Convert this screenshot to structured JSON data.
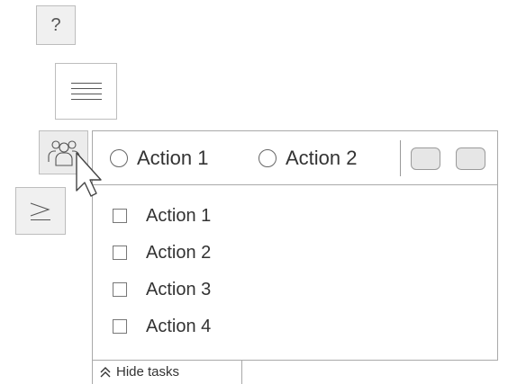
{
  "side_buttons": {
    "help": {
      "glyph": "?",
      "icon": "question-icon"
    },
    "menu": {
      "icon": "hamburger-menu-icon"
    },
    "people": {
      "icon": "people-group-icon"
    },
    "terminal": {
      "icon": "terminal-prompt-icon"
    }
  },
  "panel": {
    "radios": [
      {
        "label": "Action 1"
      },
      {
        "label": "Action 2"
      }
    ],
    "tasks": [
      {
        "label": "Action 1"
      },
      {
        "label": "Action 2"
      },
      {
        "label": "Action 3"
      },
      {
        "label": "Action 4"
      }
    ],
    "footer": {
      "label": "Hide tasks",
      "icon": "double-chevron-up-icon"
    }
  },
  "colors": {
    "border": "#a9a9a9",
    "button_bg": "#f0f0f0"
  }
}
